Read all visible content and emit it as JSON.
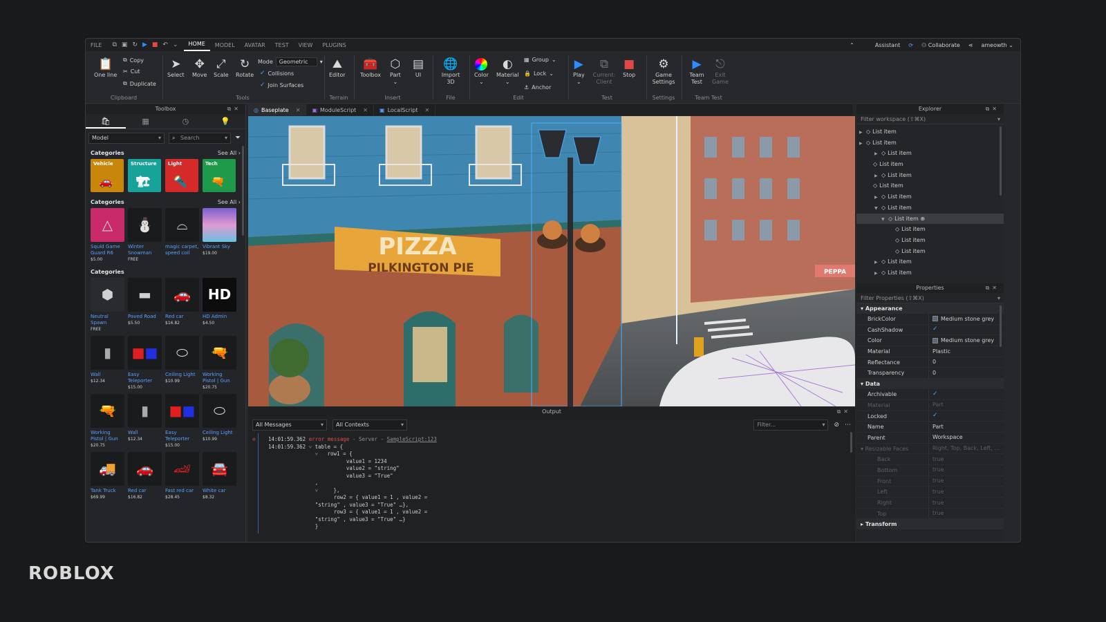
{
  "menubar": {
    "file": "FILE",
    "tabs": [
      "HOME",
      "MODEL",
      "AVATAR",
      "TEST",
      "VIEW",
      "PLUGINS"
    ],
    "assistant": "Assistant",
    "collaborate": "Collaborate",
    "user": "ameowth"
  },
  "ribbon": {
    "clipboard": {
      "label": "Clipboard",
      "one_line": "One line",
      "copy": "Copy",
      "cut": "Cut",
      "duplicate": "Duplicate"
    },
    "tools": {
      "label": "Tools",
      "select": "Select",
      "move": "Move",
      "scale": "Scale",
      "rotate": "Rotate",
      "mode_label": "Mode",
      "mode_value": "Geometric",
      "collisions": "Collisions",
      "join_surfaces": "Join Surfaces"
    },
    "terrain": {
      "label": "Terrain",
      "editor": "Editor"
    },
    "insert": {
      "label": "Insert",
      "toolbox": "Toolbox",
      "part": "Part",
      "ui": "UI"
    },
    "file": {
      "label": "File",
      "import3d": "Import 3D"
    },
    "edit": {
      "label": "Edit",
      "color": "Color",
      "material": "Material",
      "group": "Group",
      "lock": "Lock",
      "anchor": "Anchor"
    },
    "test": {
      "label": "Test",
      "play": "Play",
      "current_client": "Current: Client",
      "stop": "Stop"
    },
    "settings": {
      "label": "Settings",
      "game_settings": "Game Settings"
    },
    "team_test": {
      "label": "Team Test",
      "team_test": "Team Test",
      "exit_game": "Exit Game"
    }
  },
  "toolbox": {
    "title": "Toolbox",
    "filter_value": "Model",
    "search_placeholder": "Search",
    "categories_1": {
      "label": "Categories",
      "see_all": "See All"
    },
    "cat_tiles": [
      {
        "label": "Vehicle",
        "color": "#c8860a"
      },
      {
        "label": "Structure",
        "color": "#18a39a"
      },
      {
        "label": "Light",
        "color": "#d52a2a"
      },
      {
        "label": "Tech",
        "color": "#1e9a4a"
      }
    ],
    "categories_2": {
      "label": "Categories",
      "see_all": "See All"
    },
    "row_a": [
      {
        "name": "Squid Game Guard R6",
        "price": "$5.00"
      },
      {
        "name": "Winter Snowman",
        "price": "FREE"
      },
      {
        "name": "magic carpet, speed coil",
        "price": ""
      },
      {
        "name": "Vibrant Sky",
        "price": "$19.00"
      }
    ],
    "categories_3": {
      "label": "Categories"
    },
    "row_b": [
      {
        "name": "Neutral Spawn",
        "price": "FREE"
      },
      {
        "name": "Paved Road",
        "price": "$5.50"
      },
      {
        "name": "Red car",
        "price": "$16.82"
      },
      {
        "name": "HD Admin",
        "price": "$4.50"
      }
    ],
    "row_c": [
      {
        "name": "Wall",
        "price": "$12.34"
      },
      {
        "name": "Easy Teleporter",
        "price": "$15.00"
      },
      {
        "name": "Ceiling Light",
        "price": "$10.99"
      },
      {
        "name": "Working Pistol | Gun",
        "price": "$20.75"
      }
    ],
    "row_d": [
      {
        "name": "Working Pistol | Gun",
        "price": "$20.75"
      },
      {
        "name": "Wall",
        "price": "$12.34"
      },
      {
        "name": "Easy Teleporter",
        "price": "$15.00"
      },
      {
        "name": "Ceiling Light",
        "price": "$10.99"
      }
    ],
    "row_e": [
      {
        "name": "Tank Truck",
        "price": "$69.99"
      },
      {
        "name": "Red car",
        "price": "$16.82"
      },
      {
        "name": "Fast red car",
        "price": "$28.45"
      },
      {
        "name": "White car",
        "price": "$8.32"
      }
    ],
    "hd_text": "HD"
  },
  "doctabs": [
    "Baseplate",
    "ModuleScript",
    "LocalScript"
  ],
  "viewport": {
    "sign_line1": "PIZZA",
    "sign_line2": "PILKINGTON PIE",
    "side_sign": "PEPPA"
  },
  "output": {
    "title": "Output",
    "messages_filter": "All Messages",
    "contexts_filter": "All Contexts",
    "filter_placeholder": "Filter...",
    "line1_time": "14:01:59.362",
    "line1_msg": "error message",
    "line1_src": "Server",
    "line1_link": "SampleScript:123",
    "line2_time": "14:01:59.362",
    "code": "˅ table = {\n  ˅   row1 = {\n            value1 = 1234\n            value2 = \"string\"\n            value3 = \"True\"\n  ,\n  ˅     },\n        row2 = { value1 = 1 , value2 =\n  \"string\" , value3 = \"True\" …},\n        row3 = { value1 = 1 , value2 =\n  \"string\" , value3 = \"True\" …}\n  }"
  },
  "explorer": {
    "title": "Explorer",
    "filter": "Filter workspace (⇧⌘X)",
    "item_label": "List item"
  },
  "properties": {
    "title": "Properties",
    "filter": "Filter Properties (⇧⌘X)",
    "appearance": "Appearance",
    "brickcolor": {
      "k": "BrickColor",
      "v": "Medium stone grey"
    },
    "castshadow": {
      "k": "CashShadow"
    },
    "color": {
      "k": "Color",
      "v": "Medium stone grey"
    },
    "material": {
      "k": "Material",
      "v": "Plastic"
    },
    "reflectance": {
      "k": "Reflectance",
      "v": "0"
    },
    "transparency": {
      "k": "Transparency",
      "v": "0"
    },
    "data": "Data",
    "archivable": {
      "k": "Archivable"
    },
    "data_material": {
      "k": "Material",
      "v": "Part"
    },
    "locked": {
      "k": "Locked"
    },
    "name": {
      "k": "Name",
      "v": "Part"
    },
    "parent": {
      "k": "Parent",
      "v": "Workspace"
    },
    "resizable": {
      "k": "Resizable Faces",
      "v": "Right, Top, Back, Left, ..."
    },
    "faces": [
      {
        "k": "Back",
        "v": "true"
      },
      {
        "k": "Bottom",
        "v": "true"
      },
      {
        "k": "Front",
        "v": "true"
      },
      {
        "k": "Left",
        "v": "true"
      },
      {
        "k": "Right",
        "v": "true"
      },
      {
        "k": "Top",
        "v": "true"
      }
    ],
    "transform": "Transform"
  },
  "logo": "ROBLOX"
}
